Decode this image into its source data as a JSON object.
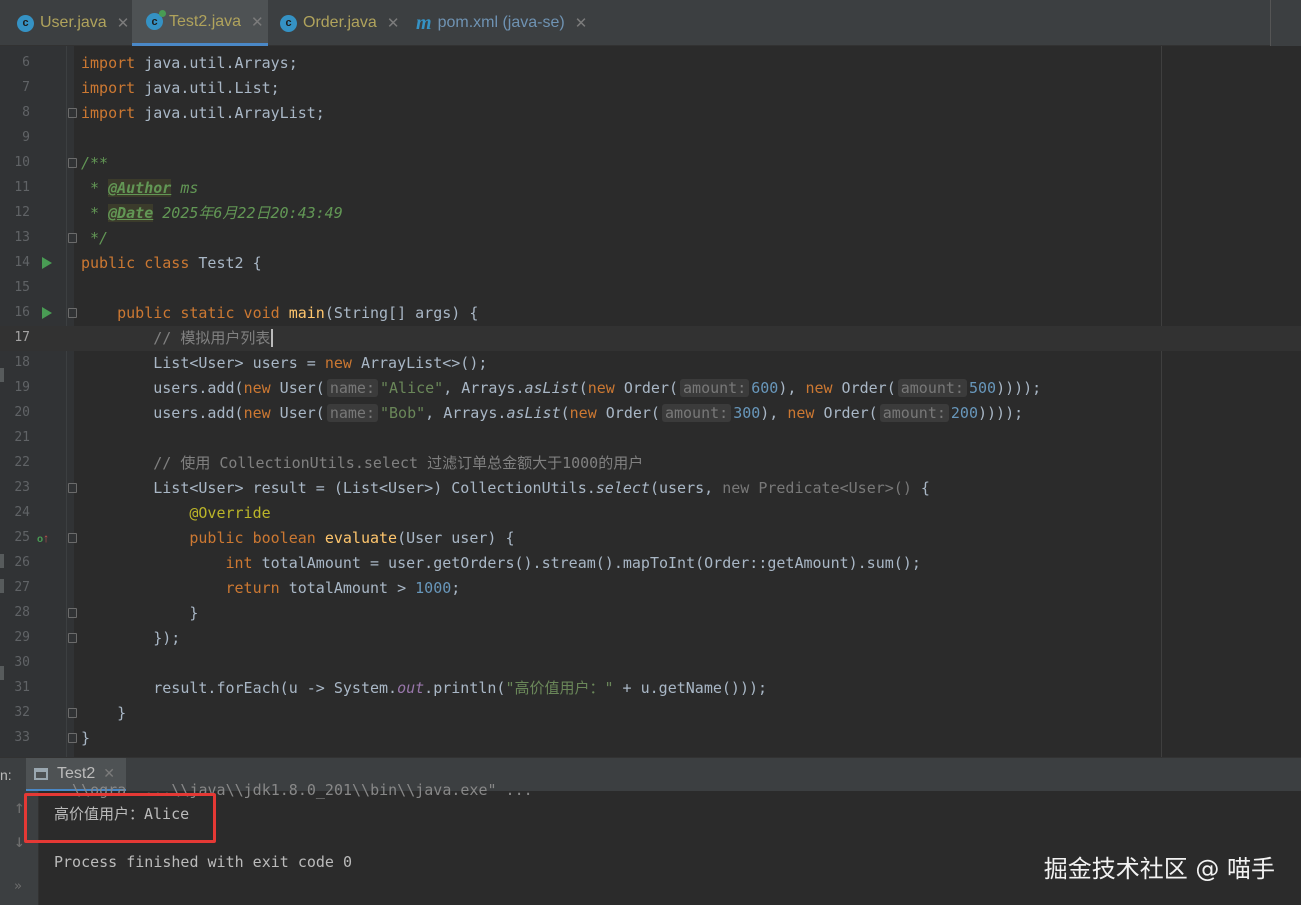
{
  "tabs": [
    {
      "label": "User.java",
      "icon": "class-icon",
      "kind": "java",
      "active": false
    },
    {
      "label": "Test2.java",
      "icon": "class-icon",
      "kind": "java",
      "active": true
    },
    {
      "label": "Order.java",
      "icon": "class-icon",
      "kind": "java",
      "active": false
    },
    {
      "label": "pom.xml (java-se)",
      "icon": "maven-icon",
      "kind": "xml",
      "active": false
    }
  ],
  "editor": {
    "current_line": 17,
    "lines": [
      {
        "n": 6,
        "html": "<span class=\"kw\">import</span> java.util.Arrays;"
      },
      {
        "n": 7,
        "html": "<span class=\"kw\">import</span> java.util.List;"
      },
      {
        "n": 8,
        "html": "<span class=\"kw\">import</span> java.util.ArrayList;",
        "fold": true
      },
      {
        "n": 9,
        "html": ""
      },
      {
        "n": 10,
        "html": "<span class=\"doc\">/**</span>",
        "fold": true
      },
      {
        "n": 11,
        "html": "<span class=\"doc\"> * <span class=\"tag\">@Author</span> ms</span>"
      },
      {
        "n": 12,
        "html": "<span class=\"doc\"> * <span class=\"tag\">@Date</span> 2025年6月22日20:43:49</span>"
      },
      {
        "n": 13,
        "html": "<span class=\"doc\"> */</span>",
        "fold": true
      },
      {
        "n": 14,
        "html": "<span class=\"kw\">public class</span> Test2 {",
        "run": true
      },
      {
        "n": 15,
        "html": ""
      },
      {
        "n": 16,
        "html": "    <span class=\"kw\">public static void</span> <span class=\"fn\">main</span>(String[] args) {",
        "run": true,
        "fold": true
      },
      {
        "n": 17,
        "html": "        <span class=\"cm\">// 模拟用户列表</span><span class=\"caret\"></span>"
      },
      {
        "n": 18,
        "html": "        List&lt;User&gt; users = <span class=\"kw\">new</span> ArrayList&lt;&gt;();"
      },
      {
        "n": 19,
        "html": "        users.add(<span class=\"kw\">new</span> User(<span class=\"hint\">name:</span><span class=\"str\">\"Alice\"</span>, Arrays.<span class=\"ital\">asList</span>(<span class=\"kw\">new</span> Order(<span class=\"hint\">amount:</span><span class=\"num\">600</span>), <span class=\"kw\">new</span> Order(<span class=\"hint\">amount:</span><span class=\"num\">500</span>))));"
      },
      {
        "n": 20,
        "html": "        users.add(<span class=\"kw\">new</span> User(<span class=\"hint\">name:</span><span class=\"str\">\"Bob\"</span>, Arrays.<span class=\"ital\">asList</span>(<span class=\"kw\">new</span> Order(<span class=\"hint\">amount:</span><span class=\"num\">300</span>), <span class=\"kw\">new</span> Order(<span class=\"hint\">amount:</span><span class=\"num\">200</span>))));"
      },
      {
        "n": 21,
        "html": ""
      },
      {
        "n": 22,
        "html": "        <span class=\"cm\">// 使用 CollectionUtils.select 过滤订单总金额大于1000的用户</span>"
      },
      {
        "n": 23,
        "html": "        List&lt;User&gt; result = (List&lt;User&gt;) CollectionUtils.<span class=\"ital\">select</span>(users, <span class=\"gray\">new Predicate&lt;User&gt;()</span> {",
        "fold": true
      },
      {
        "n": 24,
        "html": "            <span class=\"ann\">@Override</span>"
      },
      {
        "n": 25,
        "html": "            <span class=\"kw\">public boolean</span> <span class=\"fn\">evaluate</span>(User user) {",
        "override": true,
        "fold": true
      },
      {
        "n": 26,
        "html": "                <span class=\"kw\">int</span> totalAmount = user.getOrders().stream().mapToInt(Order::getAmount).sum();"
      },
      {
        "n": 27,
        "html": "                <span class=\"kw\">return</span> totalAmount &gt; <span class=\"num\">1000</span>;"
      },
      {
        "n": 28,
        "html": "            }",
        "fold": true
      },
      {
        "n": 29,
        "html": "        });",
        "fold": true
      },
      {
        "n": 30,
        "html": ""
      },
      {
        "n": 31,
        "html": "        result.forEach(u -&gt; System.<span class=\"sfld\">out</span>.println(<span class=\"str\">\"高价值用户：\"</span> + u.getName()));"
      },
      {
        "n": 32,
        "html": "    }",
        "fold": true
      },
      {
        "n": 33,
        "html": "}",
        "fold": true
      }
    ]
  },
  "run_panel": {
    "prefix": "n:",
    "tab_label": "Test2",
    "cut_line": "  \\\\ogra  ...\\\\java\\\\jdk1.8.0_201\\\\bin\\\\java.exe\" ...",
    "output_line": "高价值用户：Alice",
    "exit_line": "Process finished with exit code 0"
  },
  "watermark": "掘金技术社区 @ 喵手",
  "colors": {
    "background": "#2b2b2b",
    "keyword": "#cc7832",
    "string": "#6a8759",
    "number": "#6897bb",
    "highlight_box": "#e53935"
  }
}
